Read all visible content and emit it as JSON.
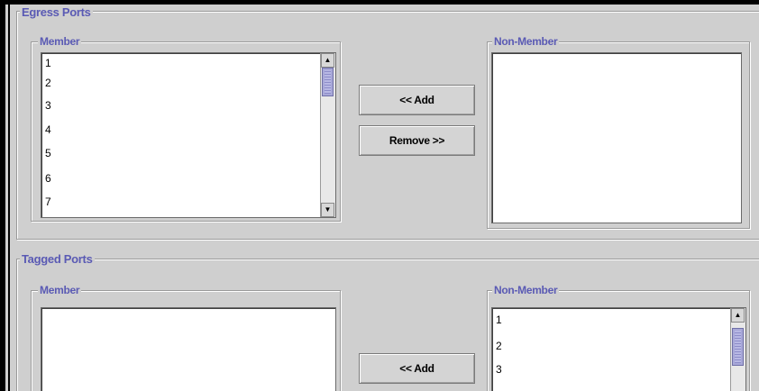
{
  "egress": {
    "title": "Egress Ports",
    "member": {
      "label": "Member",
      "items": [
        "1",
        "2",
        "3",
        "4",
        "5",
        "6",
        "7"
      ]
    },
    "non_member": {
      "label": "Non-Member",
      "items": []
    },
    "add_label": "<< Add",
    "remove_label": "Remove >>"
  },
  "tagged": {
    "title": "Tagged Ports",
    "member": {
      "label": "Member",
      "items": []
    },
    "non_member": {
      "label": "Non-Member",
      "items": [
        "1",
        "2",
        "3"
      ]
    },
    "add_label": "<< Add"
  },
  "icons": {
    "scroll_up": "arrow-up-icon",
    "scroll_down": "arrow-down-icon"
  },
  "colors": {
    "legend": "#5a5ab4",
    "panel": "#cfcfcf",
    "thumb": "#a8a8d8"
  }
}
